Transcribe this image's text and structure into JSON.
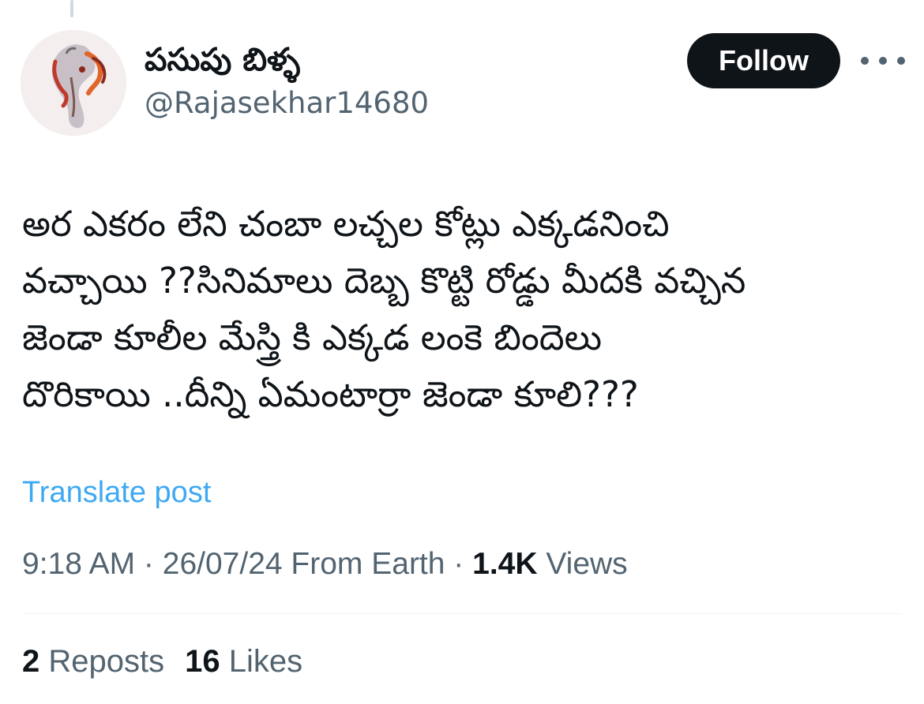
{
  "author": {
    "display_name": "పసుపు బిళ్ళ",
    "handle": "@Rajasekhar14680",
    "avatar_icon": "ganesha-avatar-icon"
  },
  "actions": {
    "follow_label": "Follow",
    "more_icon": "more-dots-icon"
  },
  "post": {
    "text": "అర ఎకరం లేని చంబా లచ్చల కోట్లు ఎక్కడనించి\nవచ్చాయి ??సినిమాలు దెబ్బ కొట్టి రోడ్డు మీదకి వచ్చిన\nజెండా కూలీల మేస్త్రి కి ఎక్కడ లంకె బిందెలు\nదొరికాయి ..దీన్ని ఏమంటార్రా జెండా కూలి???",
    "translate_label": "Translate post"
  },
  "meta": {
    "time": "9:18 AM",
    "separator": " · ",
    "date": "26/07/24",
    "location": " From Earth",
    "views_count": "1.4K",
    "views_label": " Views"
  },
  "stats": {
    "reposts_count": "2",
    "reposts_label": " Reposts",
    "likes_count": "16",
    "likes_label": " Likes"
  },
  "colors": {
    "link": "#1d9bf0",
    "secondary_text": "#536471",
    "primary_text": "#0f1419",
    "follow_bg": "#0f1419"
  }
}
